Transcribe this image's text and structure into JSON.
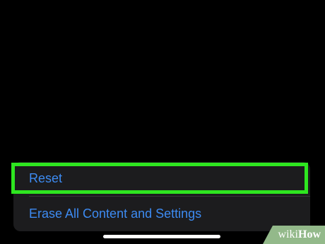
{
  "menu": {
    "items": [
      {
        "label": "Reset"
      },
      {
        "label": "Erase All Content and Settings"
      }
    ]
  },
  "watermark": {
    "prefix": "wiki",
    "suffix": "How"
  },
  "colors": {
    "background": "#000000",
    "group_background": "#1c1c1e",
    "link_text": "#3d8bf2",
    "highlight": "#2ee620"
  }
}
